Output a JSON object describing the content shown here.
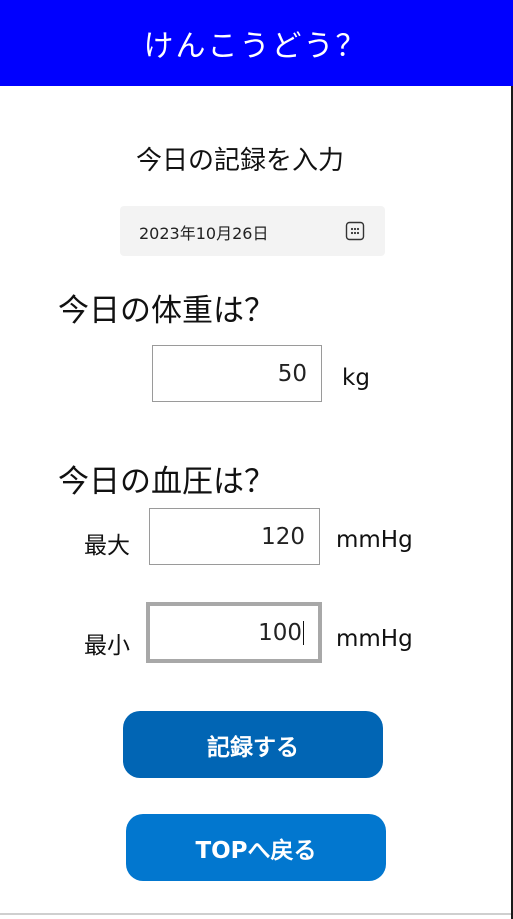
{
  "header": {
    "title": "けんこうどう？"
  },
  "record": {
    "title": "今日の記録を入力",
    "date_value": "2023年10月26日",
    "date_icon": "calendar-icon"
  },
  "weight": {
    "heading": "今日の体重は？",
    "value": "50",
    "unit": "kg"
  },
  "blood_pressure": {
    "heading": "今日の血圧は？",
    "max_label": "最大",
    "max_value": "120",
    "min_label": "最小",
    "min_value": "100",
    "unit": "mmHg"
  },
  "buttons": {
    "save_label": "記録する",
    "back_label": "TOPへ戻る"
  },
  "colors": {
    "header_bg": "#0000ff",
    "save_button_bg": "#0165b4",
    "back_button_bg": "#0277cf"
  }
}
